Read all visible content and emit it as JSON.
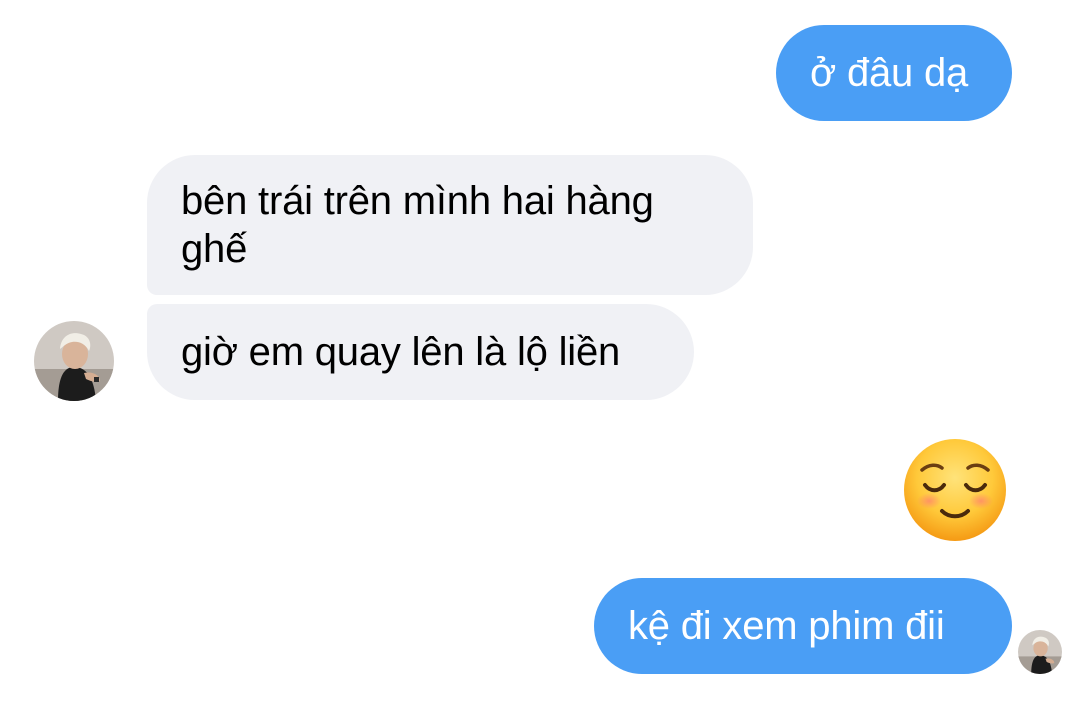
{
  "colors": {
    "outgoing_bubble": "#4a9ef5",
    "incoming_bubble": "#f0f1f5"
  },
  "messages": [
    {
      "id": "msg-1",
      "direction": "outgoing",
      "text": "ở đâu dạ"
    },
    {
      "id": "msg-2",
      "direction": "incoming",
      "text": "bên trái trên mình hai hàng ghế"
    },
    {
      "id": "msg-3",
      "direction": "incoming",
      "text": "giờ em quay lên là lộ liền"
    },
    {
      "id": "msg-4",
      "direction": "outgoing",
      "emoji": "smiling-face-with-closed-eyes"
    },
    {
      "id": "msg-5",
      "direction": "outgoing",
      "text": "kệ đi xem phim đii"
    }
  ],
  "icons": {
    "contact_avatar": "avatar-photo",
    "read_receipt": "read-receipt-avatar"
  }
}
